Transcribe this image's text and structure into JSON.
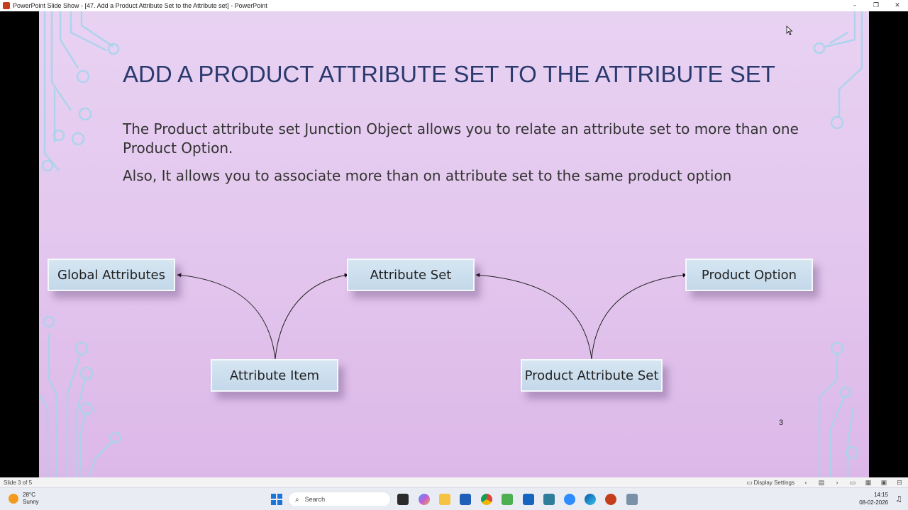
{
  "window": {
    "title": "PowerPoint Slide Show - [47. Add a Product Attribute Set to the Attribute set] - PowerPoint",
    "minimize": "–",
    "restore": "❐",
    "close": "✕"
  },
  "slide": {
    "title": "ADD A PRODUCT ATTRIBUTE SET TO THE ATTRIBUTE SET",
    "paragraph1": "The Product attribute set Junction Object allows you to relate an attribute set to more than one Product Option.",
    "paragraph2": "Also, It allows you to associate more than on attribute set to the same product option",
    "nodes": {
      "global_attributes": "Global Attributes",
      "attribute_set": "Attribute Set",
      "product_option": "Product Option",
      "attribute_item": "Attribute Item",
      "product_attribute_set": "Product Attribute Set"
    },
    "number": "3",
    "colors": {
      "title": "#2b3a6e",
      "background": "#e4c8ee",
      "node_fill": "#c9dcec",
      "circuit": "#a9d4ec"
    }
  },
  "statusbar": {
    "slide_info": "Slide 3 of 5",
    "display_settings": "Display Settings"
  },
  "taskbar": {
    "weather_temp": "28°C",
    "weather_desc": "Sunny",
    "search_placeholder": "Search",
    "time": "14:15",
    "date": "08-02-2026"
  }
}
